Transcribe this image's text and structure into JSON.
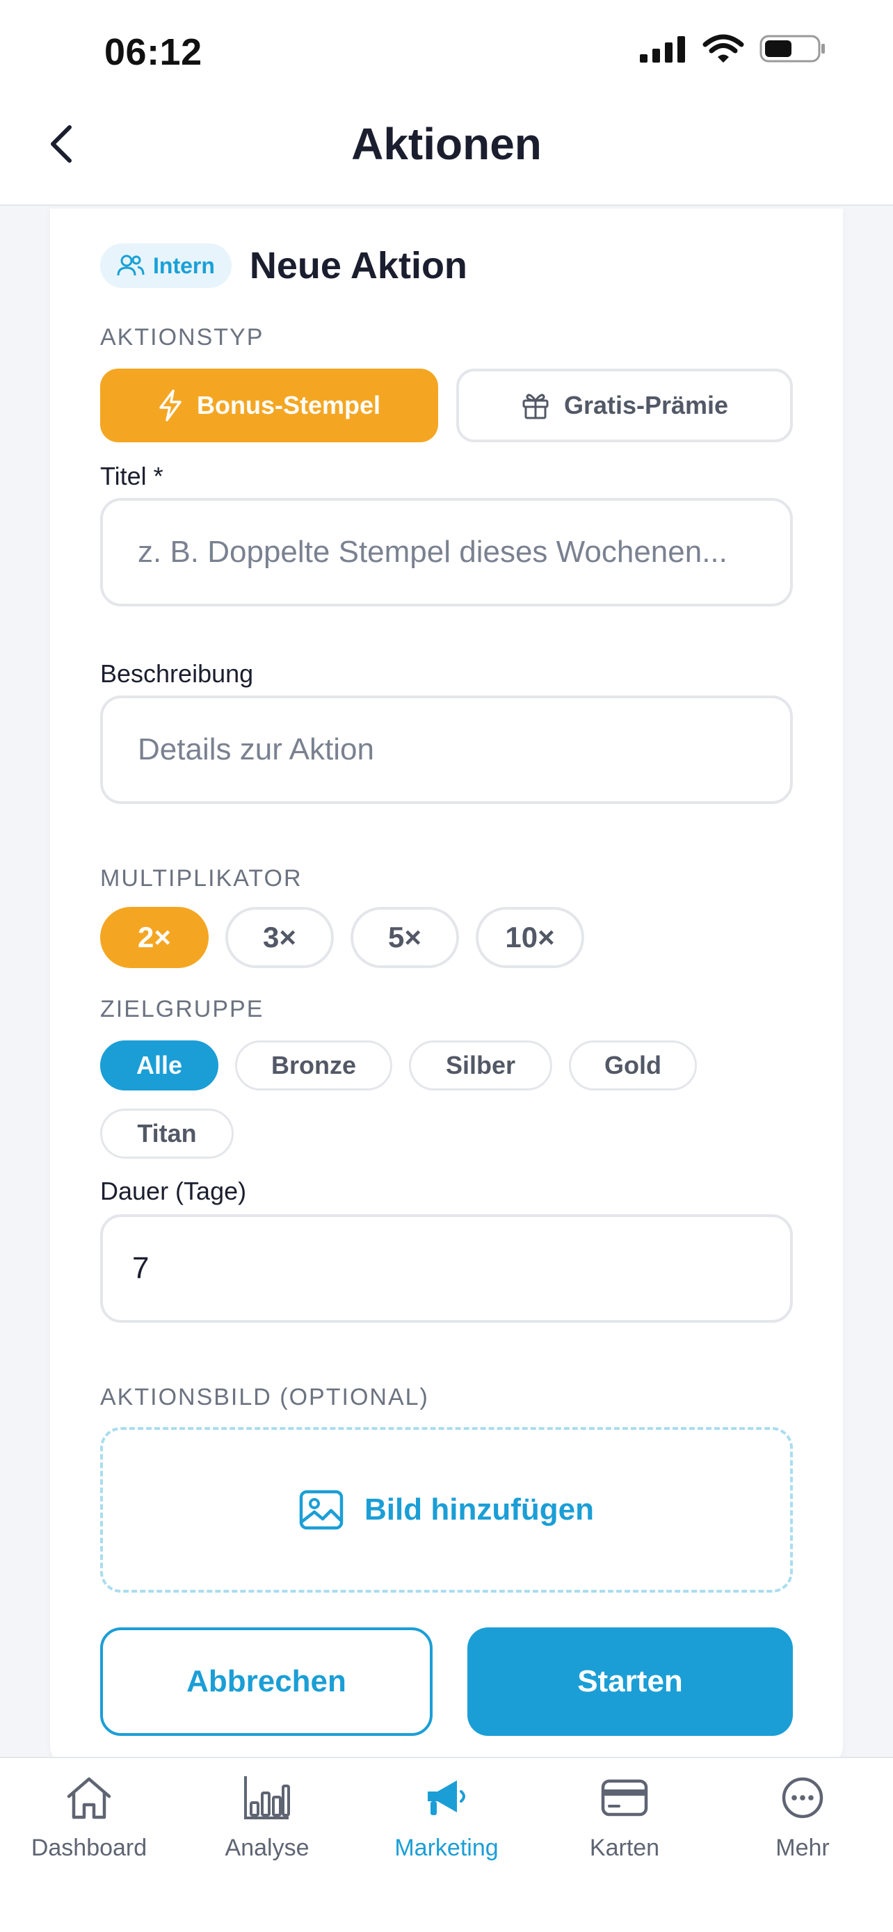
{
  "status_bar": {
    "time": "06:12"
  },
  "header": {
    "title": "Aktionen"
  },
  "card": {
    "badge": "Intern",
    "title": "Neue Aktion",
    "type_label": "AKTIONSTYP",
    "types": [
      {
        "label": "Bonus-Stempel",
        "icon": "lightning-icon",
        "selected": true
      },
      {
        "label": "Gratis-Prämie",
        "icon": "gift-icon",
        "selected": false
      }
    ],
    "title_field": {
      "label": "Titel *",
      "placeholder": "z. B. Doppelte Stempel dieses Wochenen..."
    },
    "description_field": {
      "label": "Beschreibung",
      "placeholder": "Details zur Aktion"
    },
    "multiplier_label": "MULTIPLIKATOR",
    "multipliers": [
      "2×",
      "3×",
      "5×",
      "10×"
    ],
    "multiplier_selected": "2×",
    "target_label": "ZIELGRUPPE",
    "targets": [
      "Alle",
      "Bronze",
      "Silber",
      "Gold",
      "Titan"
    ],
    "target_selected": "Alle",
    "duration_field": {
      "label": "Dauer (Tage)",
      "value": "7"
    },
    "image_label": "AKTIONSBILD (OPTIONAL)",
    "image_button": "Bild hinzufügen",
    "cancel": "Abbrechen",
    "start": "Starten"
  },
  "tabbar": {
    "items": [
      {
        "label": "Dashboard",
        "icon": "house-icon",
        "active": false
      },
      {
        "label": "Analyse",
        "icon": "bar-chart-icon",
        "active": false
      },
      {
        "label": "Marketing",
        "icon": "megaphone-icon",
        "active": true
      },
      {
        "label": "Karten",
        "icon": "card-icon",
        "active": false
      },
      {
        "label": "Mehr",
        "icon": "more-icon",
        "active": false
      }
    ]
  },
  "colors": {
    "accent_blue": "#1b9ed6",
    "accent_orange": "#f4a623",
    "text_dark": "#1b1e2e",
    "muted": "#6b7280"
  }
}
